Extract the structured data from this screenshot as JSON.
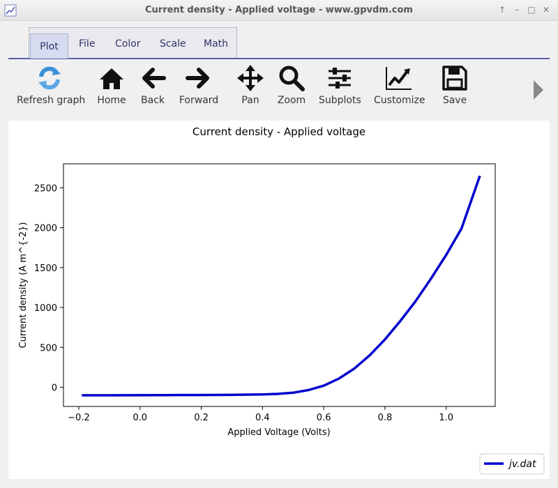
{
  "window": {
    "title": "Current density - Applied voltage - www.gpvdm.com",
    "controls": [
      "↑",
      "–",
      "□",
      "✕"
    ]
  },
  "tabs": [
    {
      "label": "Plot",
      "active": true
    },
    {
      "label": "File",
      "active": false
    },
    {
      "label": "Color",
      "active": false
    },
    {
      "label": "Scale",
      "active": false
    },
    {
      "label": "Math",
      "active": false
    }
  ],
  "toolbar": [
    {
      "label": "Refresh graph",
      "icon": "refresh-icon"
    },
    {
      "label": "Home",
      "icon": "home-icon"
    },
    {
      "label": "Back",
      "icon": "arrow-left-icon"
    },
    {
      "label": "Forward",
      "icon": "arrow-right-icon"
    },
    {
      "label": "Pan",
      "icon": "pan-icon"
    },
    {
      "label": "Zoom",
      "icon": "zoom-icon"
    },
    {
      "label": "Subplots",
      "icon": "sliders-icon"
    },
    {
      "label": "Customize",
      "icon": "chart-line-icon"
    },
    {
      "label": "Save",
      "icon": "floppy-icon"
    }
  ],
  "colors": {
    "series": "#0000cc",
    "accent": "#5a5fa8"
  },
  "chart_data": {
    "type": "line",
    "title": "Current density - Applied voltage",
    "xlabel": "Applied Voltage (Volts)",
    "ylabel": "Current density (A m^{-2})",
    "xlim": [
      -0.25,
      1.16
    ],
    "ylim": [
      -240,
      2800
    ],
    "xticks": [
      -0.2,
      0.0,
      0.2,
      0.4,
      0.6,
      0.8,
      1.0
    ],
    "xtick_labels": [
      "−0.2",
      "0.0",
      "0.2",
      "0.4",
      "0.6",
      "0.8",
      "1.0"
    ],
    "yticks": [
      0,
      500,
      1000,
      1500,
      2000,
      2500
    ],
    "ytick_labels": [
      "0",
      "500",
      "1000",
      "1500",
      "2000",
      "2500"
    ],
    "legend_position": "bottom-right",
    "grid": false,
    "series": [
      {
        "name": "jv.dat",
        "color": "#0000cc",
        "x": [
          -0.19,
          -0.1,
          0.0,
          0.1,
          0.2,
          0.3,
          0.4,
          0.45,
          0.5,
          0.55,
          0.6,
          0.65,
          0.7,
          0.75,
          0.8,
          0.85,
          0.9,
          0.95,
          1.0,
          1.05,
          1.11
        ],
        "y": [
          -100,
          -100,
          -99,
          -98,
          -97,
          -95,
          -90,
          -83,
          -68,
          -35,
          20,
          110,
          235,
          400,
          600,
          830,
          1080,
          1360,
          1660,
          1990,
          2650
        ]
      }
    ]
  }
}
